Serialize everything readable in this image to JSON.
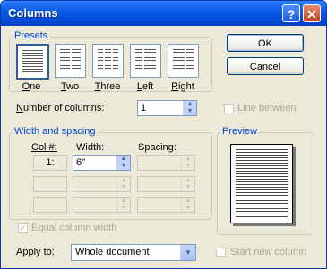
{
  "window": {
    "title": "Columns",
    "help_glyph": "?",
    "close_glyph": "✕"
  },
  "presets": {
    "group_label": "Presets",
    "items": [
      {
        "label": "One",
        "accel": "O",
        "rest": "ne",
        "icon": "one-column-icon"
      },
      {
        "label": "Two",
        "accel": "T",
        "rest": "wo",
        "icon": "two-columns-icon"
      },
      {
        "label": "Three",
        "accel": "T",
        "rest": "hree",
        "icon": "three-columns-icon"
      },
      {
        "label": "Left",
        "accel": "L",
        "rest": "eft",
        "icon": "left-column-icon"
      },
      {
        "label": "Right",
        "accel": "R",
        "rest": "ight",
        "icon": "right-column-icon"
      }
    ]
  },
  "buttons": {
    "ok": "OK",
    "cancel": "Cancel"
  },
  "number_of_columns": {
    "label_accel": "N",
    "label_rest": "umber of columns:",
    "value": "1"
  },
  "line_between": {
    "label": "Line between",
    "checked": false,
    "enabled": false
  },
  "width_spacing": {
    "group_label": "Width and spacing",
    "col_header": "Col #:",
    "width_header": "Width:",
    "spacing_header": "Spacing:",
    "rows": [
      {
        "col": "1:",
        "width": "6\"",
        "spacing": ""
      }
    ]
  },
  "equal_width": {
    "label": "Equal column width",
    "checked": true,
    "enabled": false
  },
  "preview": {
    "group_label": "Preview"
  },
  "apply_to": {
    "label_accel": "A",
    "label_rest": "pply to:",
    "value": "Whole document"
  },
  "start_new_column": {
    "label": "Start new column",
    "checked": false,
    "enabled": false
  },
  "colors": {
    "titlebar": "#0a5ce6",
    "group_label": "#0046d5",
    "dialog_bg": "#ece9d8"
  }
}
